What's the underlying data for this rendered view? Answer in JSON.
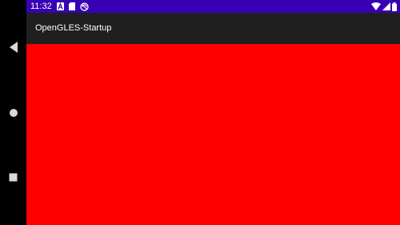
{
  "status_bar": {
    "time": "11:32",
    "left_icons": [
      "font-a-notification-icon",
      "sd-card-icon",
      "sync-notification-icon"
    ],
    "right_icons": [
      "wifi-icon",
      "cell-signal-icon",
      "battery-icon"
    ],
    "background": "#3700b3"
  },
  "app_bar": {
    "title": "OpenGLES-Startup",
    "background": "#1f1f1f"
  },
  "gl_surface": {
    "clear_color": "#ff0000"
  },
  "nav_bar": {
    "buttons": [
      "back-icon",
      "home-icon",
      "recents-icon"
    ]
  }
}
